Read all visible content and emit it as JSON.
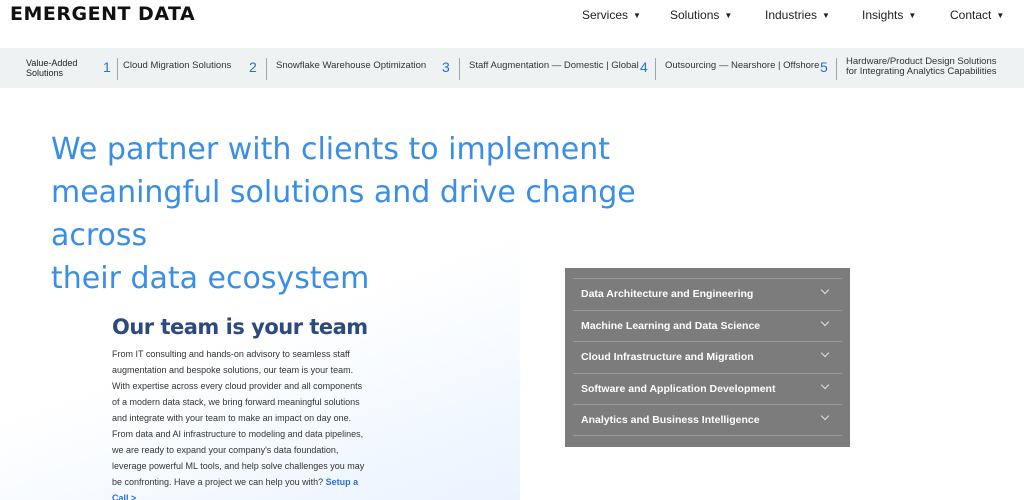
{
  "brand": {
    "logo": "EMERGENT DATA"
  },
  "nav": {
    "items": [
      {
        "label": "Services"
      },
      {
        "label": "Solutions"
      },
      {
        "label": "Industries"
      },
      {
        "label": "Insights"
      },
      {
        "label": "Contact"
      }
    ]
  },
  "value_bar": {
    "heading_line1": "Value-Added",
    "heading_line2": "Solutions",
    "items": [
      {
        "num": "1",
        "label": "Cloud Migration Solutions"
      },
      {
        "num": "2",
        "label": "Snowflake Warehouse Optimization"
      },
      {
        "num": "3",
        "label": "Staff Augmentation — Domestic | Global"
      },
      {
        "num": "4",
        "label": "Outsourcing — Nearshore | Offshore"
      },
      {
        "num": "5",
        "label_line1": "Hardware/Product Design Solutions",
        "label_line2": "for Integrating Analytics Capabilities"
      }
    ]
  },
  "hero": {
    "line1": "We partner with clients to implement",
    "line2": "meaningful solutions and drive change across",
    "line3": "their data ecosystem"
  },
  "team": {
    "title": "Our team is your team",
    "body": "From IT consulting and hands-on advisory to seamless staff augmentation and bespoke solutions, our team is your team. With expertise across every cloud provider and all components of a modern data stack, we bring forward meaningful solutions and integrate with your team to make an impact on day one.  From data and AI infrastructure to modeling and data pipelines, we are ready to expand your company's data foundation, leverage powerful ML tools, and help solve challenges you may be confronting. Have a project we can help you with? ",
    "cta": "Setup a Call >"
  },
  "services": {
    "items": [
      {
        "label": "Data Architecture and Engineering"
      },
      {
        "label": "Machine Learning and Data Science"
      },
      {
        "label": "Cloud Infrastructure and Migration"
      },
      {
        "label": "Software and Application Development"
      },
      {
        "label": "Analytics and Business Intelligence"
      }
    ]
  },
  "colors": {
    "accent_blue": "#3a8ee6",
    "number_blue": "#2b6fd4",
    "team_title": "#2c4a7c",
    "accordion_bg": "#7c7c7c",
    "value_bar_bg": "#eef2f3"
  }
}
